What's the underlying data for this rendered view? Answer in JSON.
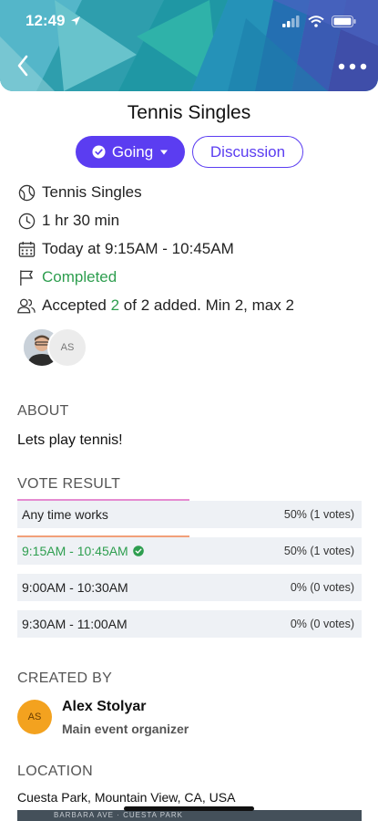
{
  "status_bar": {
    "time": "12:49"
  },
  "event": {
    "title": "Tennis Singles"
  },
  "actions": {
    "going_label": "Going",
    "discussion_label": "Discussion"
  },
  "info": {
    "activity": "Tennis Singles",
    "duration": "1 hr 30 min",
    "when": "Today at 9:15AM - 10:45AM",
    "status": "Completed",
    "accepted_prefix": "Accepted ",
    "accepted_count": "2",
    "accepted_suffix": " of 2 added. Min 2, max 2"
  },
  "participants": {
    "second_initials": "AS"
  },
  "about": {
    "heading": "ABOUT",
    "text": "Lets play tennis!"
  },
  "vote": {
    "heading": "VOTE RESULT",
    "options": [
      {
        "label": "Any time works",
        "result": "50% (1 votes)",
        "share": 0.5
      },
      {
        "label": "9:15AM - 10:45AM",
        "result": "50% (1 votes)",
        "share": 0.5,
        "selected": true
      },
      {
        "label": "9:00AM - 10:30AM",
        "result": "0% (0 votes)",
        "share": 0
      },
      {
        "label": "9:30AM - 11:00AM",
        "result": "0% (0 votes)",
        "share": 0
      }
    ]
  },
  "created_by": {
    "heading": "CREATED BY",
    "initials": "AS",
    "name": "Alex Stolyar",
    "role": "Main event organizer"
  },
  "location": {
    "heading": "LOCATION",
    "address": "Cuesta Park, Mountain View, CA, USA",
    "map_text": "BARBARA AVE · CUESTA PARK"
  },
  "colors": {
    "accent": "#5b3df1",
    "success": "#2e9e4f",
    "vote_bar_any": "#e58bd0",
    "vote_bar_selected": "#f2a07a"
  }
}
